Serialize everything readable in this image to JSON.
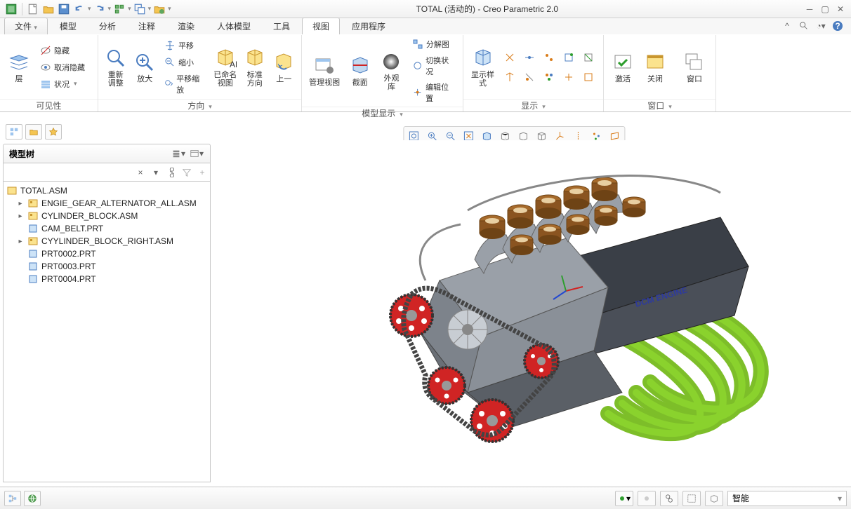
{
  "title": "TOTAL (活动的) - Creo Parametric 2.0",
  "colors": {
    "accent": "#3b82c4",
    "green": "#2e9e2e",
    "orange": "#d97c1a",
    "red": "#d02424"
  },
  "qat_icons": [
    "new",
    "open",
    "save",
    "undo",
    "redo",
    "regenerate",
    "window-mode",
    "folder-set"
  ],
  "menu": {
    "file": "文件",
    "tabs": [
      "模型",
      "分析",
      "注释",
      "渲染",
      "人体模型",
      "工具",
      "视图",
      "应用程序"
    ],
    "active": "视图"
  },
  "ribbon": {
    "groups": [
      {
        "label": "可见性",
        "layer_btn": "层",
        "small": [
          "隐藏",
          "取消隐藏",
          "状况"
        ]
      },
      {
        "label": "方向",
        "big": [
          {
            "icon": "refit",
            "label": "重新\n调整"
          },
          {
            "icon": "zoom-in",
            "label": "放大"
          }
        ],
        "small": [
          "平移",
          "缩小",
          "平移缩放"
        ]
      },
      {
        "label": "模型显示",
        "big": [
          {
            "icon": "named-views",
            "label": "已命名\n视图"
          },
          {
            "icon": "std-orient",
            "label": "标准\n方向"
          },
          {
            "icon": "prev-view",
            "label": "上一"
          },
          {
            "icon": "manage-views",
            "label": "管理视图"
          },
          {
            "icon": "section",
            "label": "截面"
          },
          {
            "icon": "appearance",
            "label": "外观\n库"
          }
        ],
        "small": [
          "分解图",
          "切换状况",
          "编辑位置"
        ]
      },
      {
        "label": "显示",
        "big": [
          {
            "icon": "display-style",
            "label": "显示样\n式"
          }
        ],
        "grid_icons": [
          "tangent",
          "edge",
          "hidden",
          "shade",
          "csys",
          "axis",
          "point",
          "plane",
          "datum",
          "note"
        ]
      },
      {
        "label": "窗口",
        "big": [
          {
            "icon": "activate",
            "label": "激活"
          },
          {
            "icon": "close",
            "label": "关闭"
          },
          {
            "icon": "window",
            "label": "窗口"
          }
        ]
      }
    ]
  },
  "view_toolbar": [
    "zoom-fit",
    "zoom-in",
    "zoom-out",
    "repaint",
    "shade",
    "hidden",
    "nohidden",
    "wireframe",
    "csys-disp",
    "axis-disp",
    "point-disp",
    "plane-disp"
  ],
  "tree": {
    "header": "模型树",
    "root": "TOTAL.ASM",
    "children": [
      {
        "type": "asm",
        "expand": true,
        "name": "ENGIE_GEAR_ALTERNATOR_ALL.ASM"
      },
      {
        "type": "asm",
        "expand": true,
        "name": "CYLINDER_BLOCK.ASM"
      },
      {
        "type": "prt",
        "expand": false,
        "name": "CAM_BELT.PRT"
      },
      {
        "type": "asm",
        "expand": true,
        "name": "CYYLINDER_BLOCK_RIGHT.ASM"
      },
      {
        "type": "prt",
        "expand": false,
        "name": "PRT0002.PRT"
      },
      {
        "type": "prt",
        "expand": false,
        "name": "PRT0003.PRT"
      },
      {
        "type": "prt",
        "expand": false,
        "name": "PRT0004.PRT"
      }
    ]
  },
  "status": {
    "filter": "智能"
  },
  "engine_label": "DCM  ENGINE"
}
